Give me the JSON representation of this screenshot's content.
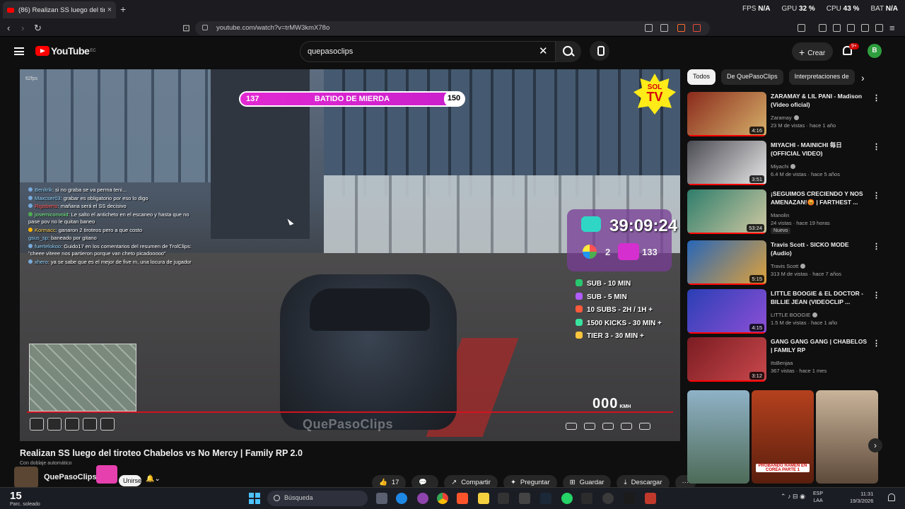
{
  "browser": {
    "tab_title": "(86) Realizan SS luego del tiroteo...",
    "tab_close": "×",
    "new_tab": "+",
    "url": "youtube.com/watch?v=trMW3kmX78o",
    "stats": [
      {
        "label": "FPS",
        "value": "N/A"
      },
      {
        "label": "GPU",
        "value": "32 %"
      },
      {
        "label": "CPU",
        "value": "43 %"
      },
      {
        "label": "BAT",
        "value": "N/A"
      }
    ]
  },
  "youtube": {
    "logo_text": "YouTube",
    "logo_region": "EC",
    "search_query": "quepasoclips",
    "search_clear": "✕",
    "create_label": "Crear",
    "create_plus": "+",
    "notifications_badge": "9+",
    "avatar_letter": "B"
  },
  "video": {
    "fps_overlay": "62fps",
    "banner_left": "137",
    "banner_text": "BATIDO DE MIERDA",
    "banner_right": "150",
    "sol_top": "SOL",
    "sol_bottom": "TV",
    "timer": "39:09:24",
    "viewers": "2",
    "followers": "133",
    "watermark": "QuePasoClips",
    "speed": "000",
    "speed_unit": "KMH",
    "rewards": [
      {
        "text": "SUB - 10 MIN",
        "color": "#28c76f"
      },
      {
        "text": "SUB - 5 MIN",
        "color": "#b05cff"
      },
      {
        "text": "10 SUBS - 2H / 1H +",
        "color": "#ff5a3c"
      },
      {
        "text": "1500 KICKS - 30 MIN +",
        "color": "#39e39f"
      },
      {
        "text": "TIER 3 - 30 MIN +",
        "color": "#ffc53d"
      }
    ],
    "chat": [
      {
        "user": "Benitrik",
        "msg": ": si no graba se va perma teni...",
        "color": ""
      },
      {
        "user": "Maxcser03",
        "msg": ": grabar es obligatorio por eso lo digo",
        "color": ""
      },
      {
        "user": "Rigoberto",
        "msg": ": mañana será el SS decisivo",
        "color": "red"
      },
      {
        "user": "josemiconvoid",
        "msg": ": Le salto el anticheto en el escaneo y hasta que no pase pov no le quitan baneo",
        "color": "green"
      },
      {
        "user": "Kormacc",
        "msg": ": ganaron 2 tiroteos pero a que costo",
        "color": "gold"
      },
      {
        "user": "gsus_sp",
        "msg": ": baneado por gitano",
        "color": ""
      },
      {
        "user": "fuertelokoo",
        "msg": ": Guido17 en los comentarios del resumen de TrolClips: \"cheee viteee nos partieron porque van cheto picadooooo\"",
        "color": ""
      },
      {
        "user": "xhero",
        "msg": ": ya se sabe que es el mejor de five m, una locura de jugador",
        "color": ""
      }
    ],
    "title": "Realizan SS luego del tiroteo Chabelos vs No Mercy | Family RP 2.0",
    "dub_label": "Con doblaje automático",
    "channel_name": "QuePasoClips",
    "subscribe_label": "Unirse",
    "like_count": "17",
    "actions": [
      {
        "icon": "👍",
        "label": "17"
      },
      {
        "icon": "💬",
        "label": ""
      },
      {
        "icon": "↗",
        "label": "Compartir"
      },
      {
        "icon": "✦",
        "label": "Preguntar"
      },
      {
        "icon": "⊞",
        "label": "Guardar"
      },
      {
        "icon": "⤓",
        "label": "Descargar"
      },
      {
        "icon": "",
        "label": "···"
      }
    ]
  },
  "sidebar": {
    "chips": [
      "Todos",
      "De QuePasoClips",
      "Interpretaciones de"
    ],
    "recommendations": [
      {
        "title": "ZARAMAY & LIL PANI - Madison (Video oficial)",
        "channel": "Zaramay",
        "meta": "23 M de vistas · hace 1 año",
        "duration": "4:16",
        "new": "",
        "bg": "#8a2a1c"
      },
      {
        "title": "MIYACHI - MAINICHI 毎日 (OFFICIAL VIDEO)",
        "channel": "Miyachi",
        "meta": "6.4 M de vistas · hace 5 años",
        "duration": "3:51",
        "new": "",
        "bg": "#4a4a52"
      },
      {
        "title": "¡SEGUIMOS CRECIENDO Y NOS AMENAZAN!😡 | FARTHEST ...",
        "channel": "Manolin",
        "meta": "24 vistas · hace 19 horas",
        "duration": "53:24",
        "new": "Nuevo",
        "bg": "#2e7d6b"
      },
      {
        "title": "Travis Scott - SICKO MODE (Audio)",
        "channel": "Travis Scott",
        "meta": "313 M de vistas · hace 7 años",
        "duration": "5:15",
        "new": "",
        "bg": "#2766b8"
      },
      {
        "title": "LITTLE BOOGIE & EL DOCTOR - BILLIE JEAN (VIDEOCLIP ...",
        "channel": "LITTLE BOOGIE",
        "meta": "1.5 M de vistas · hace 1 año",
        "duration": "4:15",
        "new": "",
        "bg": "#2a3fb5"
      },
      {
        "title": "GANG GANG GANG | CHABELOS | FAMILY RP",
        "channel": "ItsBenjaa",
        "meta": "367 vistas · hace 1 mes",
        "duration": "3:12",
        "new": "",
        "bg": "#7a1c22"
      }
    ],
    "shorts": [
      {
        "bg": "#6d8a9c"
      },
      {
        "bg": "#b5411e",
        "caption": "PROBANDO RAMEN EN COREA PARTE 1"
      },
      {
        "bg": "#8c7560"
      }
    ]
  },
  "taskbar": {
    "weather_temp": "15",
    "weather_label": "Parc. soleado",
    "search_placeholder": "Búsqueda",
    "lang_top": "ESP",
    "lang_bottom": "LAA",
    "time": "11:31",
    "date": "19/3/2026"
  }
}
